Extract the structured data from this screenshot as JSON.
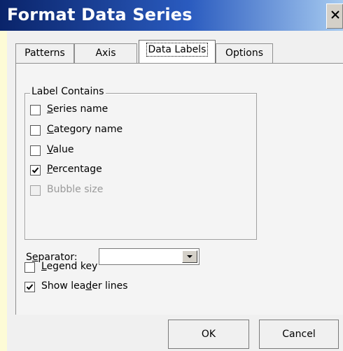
{
  "window": {
    "title": "Format Data Series",
    "close_icon": "close-icon"
  },
  "tabs": [
    {
      "label": "Patterns",
      "active": false
    },
    {
      "label": "Axis",
      "active": false
    },
    {
      "label": "Data Labels",
      "active": true
    },
    {
      "label": "Options",
      "active": false
    }
  ],
  "label_contains": {
    "title": "Label Contains",
    "items": [
      {
        "pre": "",
        "key": "S",
        "post": "eries name",
        "checked": false,
        "enabled": true
      },
      {
        "pre": "",
        "key": "C",
        "post": "ategory name",
        "checked": false,
        "enabled": true
      },
      {
        "pre": "",
        "key": "V",
        "post": "alue",
        "checked": false,
        "enabled": true
      },
      {
        "pre": "",
        "key": "P",
        "post": "ercentage",
        "checked": true,
        "enabled": true
      },
      {
        "pre": "Bubble size",
        "key": "",
        "post": "",
        "checked": false,
        "enabled": false
      }
    ]
  },
  "separator": {
    "pre": "S",
    "key": "e",
    "post": "parator:",
    "value": "",
    "dropdown_icon": "chevron-down-icon"
  },
  "options": [
    {
      "pre": "",
      "key": "L",
      "post": "egend key",
      "checked": false
    },
    {
      "pre": "Show lea",
      "key": "d",
      "post": "er lines",
      "checked": true
    }
  ],
  "buttons": {
    "ok": "OK",
    "cancel": "Cancel"
  }
}
